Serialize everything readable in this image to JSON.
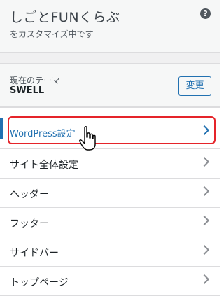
{
  "header": {
    "site_title": "しごとFUNくらぶ",
    "subtitle": "をカスタマイズ中です",
    "help_icon": "question-circle-icon"
  },
  "theme": {
    "label": "現在のテーマ",
    "name": "SWELL",
    "change_button": "変更"
  },
  "menu": {
    "items": [
      {
        "label": "WordPress設定",
        "active": true
      },
      {
        "label": "サイト全体設定"
      },
      {
        "label": "ヘッダー"
      },
      {
        "label": "フッター"
      },
      {
        "label": "サイドバー"
      },
      {
        "label": "トップページ"
      }
    ]
  },
  "colors": {
    "accent": "#2271b1",
    "highlight": "#e5242a"
  }
}
